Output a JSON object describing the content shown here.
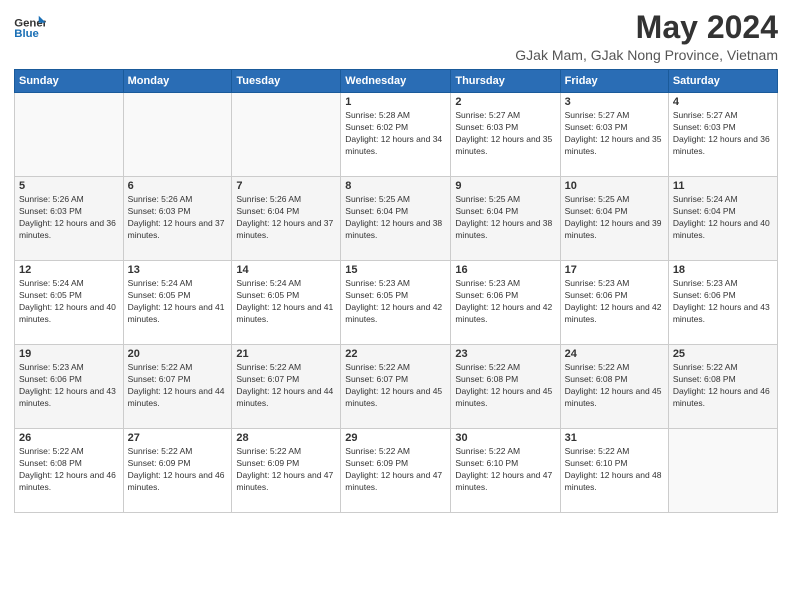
{
  "header": {
    "logo_line1": "General",
    "logo_line2": "Blue",
    "title": "May 2024",
    "subtitle": "GJak Mam, GJak Nong Province, Vietnam"
  },
  "columns": [
    "Sunday",
    "Monday",
    "Tuesday",
    "Wednesday",
    "Thursday",
    "Friday",
    "Saturday"
  ],
  "weeks": [
    [
      {
        "day": "",
        "sunrise": "",
        "sunset": "",
        "daylight": ""
      },
      {
        "day": "",
        "sunrise": "",
        "sunset": "",
        "daylight": ""
      },
      {
        "day": "",
        "sunrise": "",
        "sunset": "",
        "daylight": ""
      },
      {
        "day": "1",
        "sunrise": "Sunrise: 5:28 AM",
        "sunset": "Sunset: 6:02 PM",
        "daylight": "Daylight: 12 hours and 34 minutes."
      },
      {
        "day": "2",
        "sunrise": "Sunrise: 5:27 AM",
        "sunset": "Sunset: 6:03 PM",
        "daylight": "Daylight: 12 hours and 35 minutes."
      },
      {
        "day": "3",
        "sunrise": "Sunrise: 5:27 AM",
        "sunset": "Sunset: 6:03 PM",
        "daylight": "Daylight: 12 hours and 35 minutes."
      },
      {
        "day": "4",
        "sunrise": "Sunrise: 5:27 AM",
        "sunset": "Sunset: 6:03 PM",
        "daylight": "Daylight: 12 hours and 36 minutes."
      }
    ],
    [
      {
        "day": "5",
        "sunrise": "Sunrise: 5:26 AM",
        "sunset": "Sunset: 6:03 PM",
        "daylight": "Daylight: 12 hours and 36 minutes."
      },
      {
        "day": "6",
        "sunrise": "Sunrise: 5:26 AM",
        "sunset": "Sunset: 6:03 PM",
        "daylight": "Daylight: 12 hours and 37 minutes."
      },
      {
        "day": "7",
        "sunrise": "Sunrise: 5:26 AM",
        "sunset": "Sunset: 6:04 PM",
        "daylight": "Daylight: 12 hours and 37 minutes."
      },
      {
        "day": "8",
        "sunrise": "Sunrise: 5:25 AM",
        "sunset": "Sunset: 6:04 PM",
        "daylight": "Daylight: 12 hours and 38 minutes."
      },
      {
        "day": "9",
        "sunrise": "Sunrise: 5:25 AM",
        "sunset": "Sunset: 6:04 PM",
        "daylight": "Daylight: 12 hours and 38 minutes."
      },
      {
        "day": "10",
        "sunrise": "Sunrise: 5:25 AM",
        "sunset": "Sunset: 6:04 PM",
        "daylight": "Daylight: 12 hours and 39 minutes."
      },
      {
        "day": "11",
        "sunrise": "Sunrise: 5:24 AM",
        "sunset": "Sunset: 6:04 PM",
        "daylight": "Daylight: 12 hours and 40 minutes."
      }
    ],
    [
      {
        "day": "12",
        "sunrise": "Sunrise: 5:24 AM",
        "sunset": "Sunset: 6:05 PM",
        "daylight": "Daylight: 12 hours and 40 minutes."
      },
      {
        "day": "13",
        "sunrise": "Sunrise: 5:24 AM",
        "sunset": "Sunset: 6:05 PM",
        "daylight": "Daylight: 12 hours and 41 minutes."
      },
      {
        "day": "14",
        "sunrise": "Sunrise: 5:24 AM",
        "sunset": "Sunset: 6:05 PM",
        "daylight": "Daylight: 12 hours and 41 minutes."
      },
      {
        "day": "15",
        "sunrise": "Sunrise: 5:23 AM",
        "sunset": "Sunset: 6:05 PM",
        "daylight": "Daylight: 12 hours and 42 minutes."
      },
      {
        "day": "16",
        "sunrise": "Sunrise: 5:23 AM",
        "sunset": "Sunset: 6:06 PM",
        "daylight": "Daylight: 12 hours and 42 minutes."
      },
      {
        "day": "17",
        "sunrise": "Sunrise: 5:23 AM",
        "sunset": "Sunset: 6:06 PM",
        "daylight": "Daylight: 12 hours and 42 minutes."
      },
      {
        "day": "18",
        "sunrise": "Sunrise: 5:23 AM",
        "sunset": "Sunset: 6:06 PM",
        "daylight": "Daylight: 12 hours and 43 minutes."
      }
    ],
    [
      {
        "day": "19",
        "sunrise": "Sunrise: 5:23 AM",
        "sunset": "Sunset: 6:06 PM",
        "daylight": "Daylight: 12 hours and 43 minutes."
      },
      {
        "day": "20",
        "sunrise": "Sunrise: 5:22 AM",
        "sunset": "Sunset: 6:07 PM",
        "daylight": "Daylight: 12 hours and 44 minutes."
      },
      {
        "day": "21",
        "sunrise": "Sunrise: 5:22 AM",
        "sunset": "Sunset: 6:07 PM",
        "daylight": "Daylight: 12 hours and 44 minutes."
      },
      {
        "day": "22",
        "sunrise": "Sunrise: 5:22 AM",
        "sunset": "Sunset: 6:07 PM",
        "daylight": "Daylight: 12 hours and 45 minutes."
      },
      {
        "day": "23",
        "sunrise": "Sunrise: 5:22 AM",
        "sunset": "Sunset: 6:08 PM",
        "daylight": "Daylight: 12 hours and 45 minutes."
      },
      {
        "day": "24",
        "sunrise": "Sunrise: 5:22 AM",
        "sunset": "Sunset: 6:08 PM",
        "daylight": "Daylight: 12 hours and 45 minutes."
      },
      {
        "day": "25",
        "sunrise": "Sunrise: 5:22 AM",
        "sunset": "Sunset: 6:08 PM",
        "daylight": "Daylight: 12 hours and 46 minutes."
      }
    ],
    [
      {
        "day": "26",
        "sunrise": "Sunrise: 5:22 AM",
        "sunset": "Sunset: 6:08 PM",
        "daylight": "Daylight: 12 hours and 46 minutes."
      },
      {
        "day": "27",
        "sunrise": "Sunrise: 5:22 AM",
        "sunset": "Sunset: 6:09 PM",
        "daylight": "Daylight: 12 hours and 46 minutes."
      },
      {
        "day": "28",
        "sunrise": "Sunrise: 5:22 AM",
        "sunset": "Sunset: 6:09 PM",
        "daylight": "Daylight: 12 hours and 47 minutes."
      },
      {
        "day": "29",
        "sunrise": "Sunrise: 5:22 AM",
        "sunset": "Sunset: 6:09 PM",
        "daylight": "Daylight: 12 hours and 47 minutes."
      },
      {
        "day": "30",
        "sunrise": "Sunrise: 5:22 AM",
        "sunset": "Sunset: 6:10 PM",
        "daylight": "Daylight: 12 hours and 47 minutes."
      },
      {
        "day": "31",
        "sunrise": "Sunrise: 5:22 AM",
        "sunset": "Sunset: 6:10 PM",
        "daylight": "Daylight: 12 hours and 48 minutes."
      },
      {
        "day": "",
        "sunrise": "",
        "sunset": "",
        "daylight": ""
      }
    ]
  ]
}
